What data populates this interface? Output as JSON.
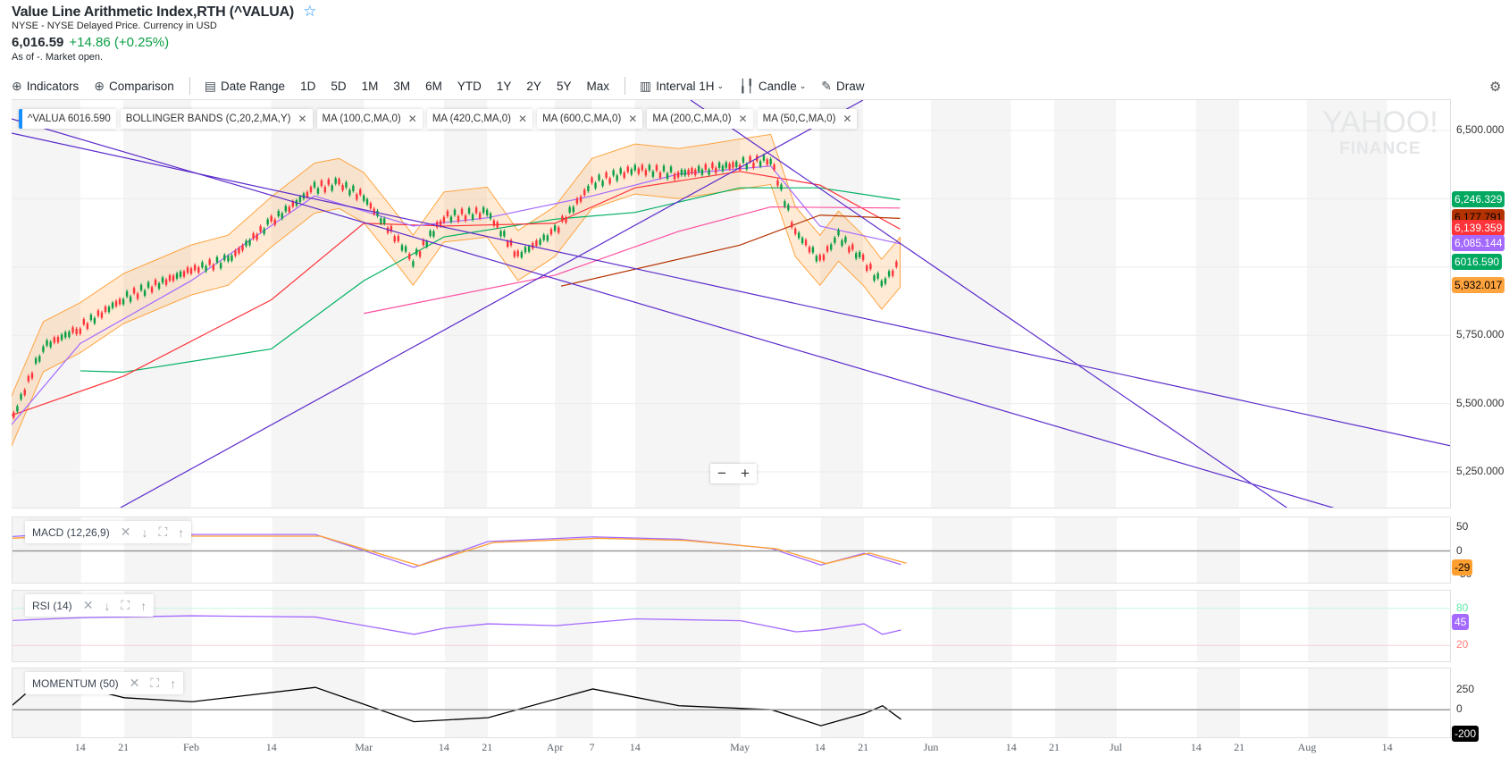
{
  "header": {
    "title": "Value Line Arithmetic Index,RTH (^VALUA)",
    "star_icon": "star-outline-icon",
    "subtitle": "NYSE - NYSE Delayed Price. Currency in USD",
    "price": "6,016.59",
    "change": "+14.86 (+0.25%)",
    "as_of": "As of -. Market open."
  },
  "toolbar": {
    "indicators": "Indicators",
    "comparison": "Comparison",
    "date_range": "Date Range",
    "ranges": [
      "1D",
      "5D",
      "1M",
      "3M",
      "6M",
      "YTD",
      "1Y",
      "2Y",
      "5Y",
      "Max"
    ],
    "interval": "Interval",
    "interval_value": "1H",
    "chart_type": "Candle",
    "draw": "Draw"
  },
  "tags": [
    "^VALUA 6016.590",
    "BOLLINGER BANDS (C,20,2,MA,Y)",
    "MA (100,C,MA,0)",
    "MA (420,C,MA,0)",
    "MA (600,C,MA,0)",
    "MA (200,C,MA,0)",
    "MA (50,C,MA,0)"
  ],
  "watermark": {
    "line1": "YAHOO!",
    "line2": "FINANCE"
  },
  "zoom": {
    "minus": "−",
    "plus": "+"
  },
  "colors": {
    "up": "#0b9f45",
    "down": "#ff333a",
    "bands": "#ffa33f",
    "green_ma": "#00b061",
    "red_ma": "#ff333a",
    "purple_ma": "#a46aff",
    "pink_ma": "#ff4fa0",
    "brown_ma": "#b43200",
    "trendline": "#5b2bcc"
  },
  "y_axis": {
    "ticks": [
      "6,500.000",
      "6,250.000",
      "6,000.000",
      "5,750.000",
      "5,500.000",
      "5,250.000"
    ],
    "tick_values": [
      6500,
      6250,
      6000,
      5750,
      5500,
      5250
    ]
  },
  "badges": [
    {
      "text": "6,246.329",
      "value": 6246.329,
      "color": "#00a860",
      "fg": "#fff"
    },
    {
      "text": "6,177.791",
      "value": 6177.791,
      "color": "#b43200",
      "fg": "#000"
    },
    {
      "text": "6,139.359",
      "value": 6139.359,
      "color": "#ff333a",
      "fg": "#fff"
    },
    {
      "text": "6,085.144",
      "value": 6085.144,
      "color": "#a46aff",
      "fg": "#fff"
    },
    {
      "text": "6016.590",
      "value": 6016.59,
      "color": "#00a860",
      "fg": "#fff"
    },
    {
      "text": "5,932.017",
      "value": 5932.017,
      "color": "#ffa33f",
      "fg": "#000"
    }
  ],
  "chart_data": {
    "type": "line",
    "price": {
      "dates": [
        "Jan 2",
        "Jan 8",
        "Jan 14",
        "Jan 21",
        "Feb 1",
        "Feb 7",
        "Feb 14",
        "Feb 21",
        "Feb 25",
        "Mar 1",
        "Mar 6",
        "Mar 9",
        "Mar 14",
        "Mar 21",
        "Mar 26",
        "Apr 1",
        "Apr 7",
        "Apr 14",
        "Apr 21",
        "Apr 26",
        "May 1",
        "May 6",
        "May 10",
        "May 14",
        "May 17",
        "May 21",
        "May 24",
        "May 27"
      ],
      "values": [
        5391,
        5708,
        5778,
        5884,
        5989,
        6025,
        6165,
        6289,
        6306,
        6254,
        6113,
        6025,
        6183,
        6201,
        6042,
        6130,
        6306,
        6359,
        6342,
        6359,
        6377,
        6394,
        6130,
        6025,
        6113,
        6025,
        5937,
        6017
      ]
    },
    "ma_series": [
      {
        "name": "MA (100,C,MA,0)",
        "color": "#00b061",
        "dates": [
          "Jan 14",
          "Jan 21",
          "Feb 14",
          "Mar 1",
          "Mar 14",
          "Apr 1",
          "Apr 14",
          "May 1",
          "May 14",
          "May 27"
        ],
        "values": [
          5620,
          5615,
          5700,
          5950,
          6110,
          6175,
          6200,
          6290,
          6290,
          6246
        ]
      },
      {
        "name": "MA (50,C,MA,0)",
        "color": "#ff333a",
        "dates": [
          "Jan 2",
          "Jan 21",
          "Feb 14",
          "Mar 1",
          "Mar 14",
          "Apr 1",
          "Apr 14",
          "May 1",
          "May 14",
          "May 27"
        ],
        "values": [
          5450,
          5600,
          5880,
          6160,
          6150,
          6160,
          6290,
          6350,
          6300,
          6139
        ]
      },
      {
        "name": "Bollinger mid",
        "color": "#a46aff",
        "dates": [
          "Jan 2",
          "Jan 14",
          "Feb 1",
          "Feb 21",
          "Mar 9",
          "Mar 21",
          "Apr 7",
          "Apr 21",
          "May 6",
          "May 14",
          "May 27"
        ],
        "values": [
          5400,
          5720,
          5950,
          6260,
          6150,
          6180,
          6260,
          6340,
          6370,
          6150,
          6085
        ]
      },
      {
        "name": "MA (200,C,MA,0)",
        "color": "#ff4fa0",
        "dates": [
          "Mar 1",
          "Apr 1",
          "Apr 21",
          "May 6",
          "May 27"
        ],
        "values": [
          5830,
          5970,
          6130,
          6220,
          6216
        ]
      },
      {
        "name": "MA (420,C,MA,0)",
        "color": "#b43200",
        "dates": [
          "Apr 2",
          "May 1",
          "May 14",
          "May 27"
        ],
        "values": [
          5930,
          6080,
          6190,
          6178
        ]
      }
    ],
    "x_ticks": [
      "14",
      "21",
      "Feb",
      "14",
      "Mar",
      "14",
      "21",
      "Apr",
      "7",
      "14",
      "May",
      "14",
      "21",
      "Jun",
      "14",
      "21",
      "Jul",
      "14",
      "21",
      "Aug",
      "14"
    ],
    "x_tick_dates": [
      "Jan 14",
      "Jan 21",
      "Feb 1",
      "Feb 14",
      "Mar 1",
      "Mar 14",
      "Mar 21",
      "Apr 1",
      "Apr 7",
      "Apr 14",
      "May 1",
      "May 14",
      "May 21",
      "Jun 1",
      "Jun 14",
      "Jun 21",
      "Jul 1",
      "Jul 14",
      "Jul 21",
      "Aug 1",
      "Aug 14"
    ]
  },
  "macd": {
    "label": "MACD (12,26,9)",
    "ticks": [
      "50",
      "0",
      "-50"
    ],
    "badge": "-29",
    "badge_color": "#ff9f2f",
    "dates": [
      "Jan 2",
      "Jan 14",
      "Feb 1",
      "Feb 21",
      "Mar 9",
      "Mar 21",
      "Apr 7",
      "Apr 21",
      "May 6",
      "May 14",
      "May 21",
      "May 27"
    ],
    "values": [
      30,
      40,
      35,
      35,
      -35,
      20,
      30,
      25,
      5,
      -30,
      -5,
      -29
    ]
  },
  "rsi": {
    "label": "RSI (14)",
    "ticks": [
      "80",
      "20"
    ],
    "badge": "45",
    "badge_color": "#a46aff",
    "dates": [
      "Jan 2",
      "Jan 14",
      "Feb 1",
      "Feb 21",
      "Mar 9",
      "Mar 14",
      "Mar 21",
      "Apr 1",
      "Apr 14",
      "May 1",
      "May 10",
      "May 14",
      "May 21",
      "May 24",
      "May 27"
    ],
    "values": [
      60,
      65,
      68,
      66,
      38,
      48,
      55,
      52,
      63,
      60,
      42,
      45,
      55,
      38,
      45
    ]
  },
  "momentum": {
    "label": "MOMENTUM (50)",
    "ticks": [
      "250",
      "0"
    ],
    "badge": "-200",
    "badge_color": "#000",
    "dates": [
      "Jan 2",
      "Jan 8",
      "Jan 21",
      "Feb 1",
      "Feb 21",
      "Mar 9",
      "Mar 21",
      "Apr 7",
      "Apr 21",
      "May 6",
      "May 14",
      "May 21",
      "May 24",
      "May 27"
    ],
    "values": [
      0,
      400,
      150,
      100,
      280,
      -150,
      -100,
      260,
      50,
      0,
      -200,
      -50,
      50,
      -120
    ]
  },
  "icons": {
    "indicators": "plus-circle-icon",
    "comparison": "plus-circle-icon",
    "date_range": "calendar-icon",
    "interval": "interval-icon",
    "candle": "candlestick-icon",
    "draw": "pencil-icon",
    "settings": "gear-icon"
  }
}
